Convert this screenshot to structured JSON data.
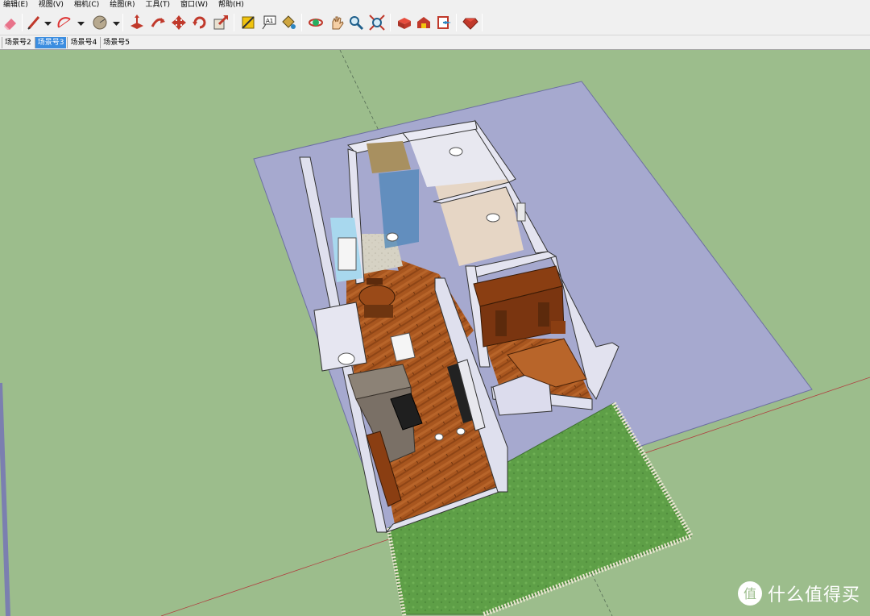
{
  "menubar": {
    "items": [
      {
        "label": "编辑(E)"
      },
      {
        "label": "视图(V)"
      },
      {
        "label": "相机(C)"
      },
      {
        "label": "绘图(R)"
      },
      {
        "label": "工具(T)"
      },
      {
        "label": "窗口(W)"
      },
      {
        "label": "帮助(H)"
      }
    ]
  },
  "toolbar": {
    "tools": [
      {
        "icon": "eraser-icon"
      },
      {
        "icon": "pencil-icon"
      },
      {
        "icon": "arc-icon"
      },
      {
        "icon": "circle-icon"
      },
      {
        "icon": "push-pull-icon"
      },
      {
        "icon": "follow-me-icon"
      },
      {
        "icon": "move-icon"
      },
      {
        "icon": "rotate-icon"
      },
      {
        "icon": "scale-icon"
      },
      {
        "icon": "tape-measure-icon"
      },
      {
        "icon": "text-icon"
      },
      {
        "icon": "paint-bucket-icon"
      },
      {
        "icon": "orbit-icon"
      },
      {
        "icon": "pan-icon"
      },
      {
        "icon": "zoom-icon"
      },
      {
        "icon": "zoom-extents-icon"
      },
      {
        "icon": "component-icon"
      },
      {
        "icon": "warehouse-icon"
      },
      {
        "icon": "share-model-icon"
      },
      {
        "icon": "ruby-icon"
      }
    ],
    "text_tool_glyph": "A1"
  },
  "scenes": {
    "tabs": [
      {
        "label": "场景号2",
        "active": false
      },
      {
        "label": "场景号3",
        "active": true
      },
      {
        "label": "场景号4",
        "active": false
      },
      {
        "label": "场景号5",
        "active": false
      }
    ]
  },
  "watermark": {
    "logo_glyph": "值",
    "text": "什么值得买"
  },
  "colors": {
    "ground": "#9cbd8c",
    "plot": "#a6a9cf",
    "floor_wood": "#a2521e",
    "wall": "#dfe0ee",
    "grass": "#5fa04a",
    "scene_active": "#3b8de0"
  }
}
